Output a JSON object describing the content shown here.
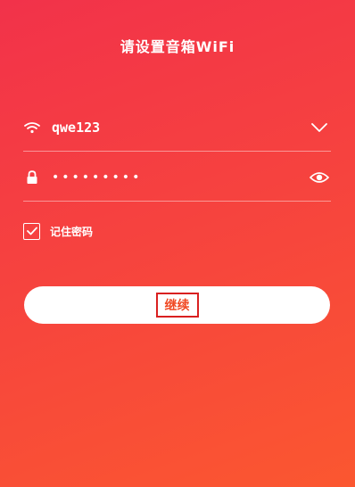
{
  "header": {
    "title": "请设置音箱WiFi"
  },
  "wifi": {
    "ssid": "qwe123",
    "icon": "wifi-icon",
    "dropdown_icon": "chevron-down-icon"
  },
  "password": {
    "masked_value": "•••••••••",
    "icon": "lock-icon",
    "toggle_icon": "eye-icon"
  },
  "remember": {
    "checked": true,
    "label": "记住密码"
  },
  "actions": {
    "continue_label": "继续"
  },
  "colors": {
    "gradient_start": "#f2324a",
    "gradient_end": "#fb5730",
    "button_bg": "#ffffff",
    "button_text": "#f04a24",
    "highlight_box": "#d92020"
  }
}
